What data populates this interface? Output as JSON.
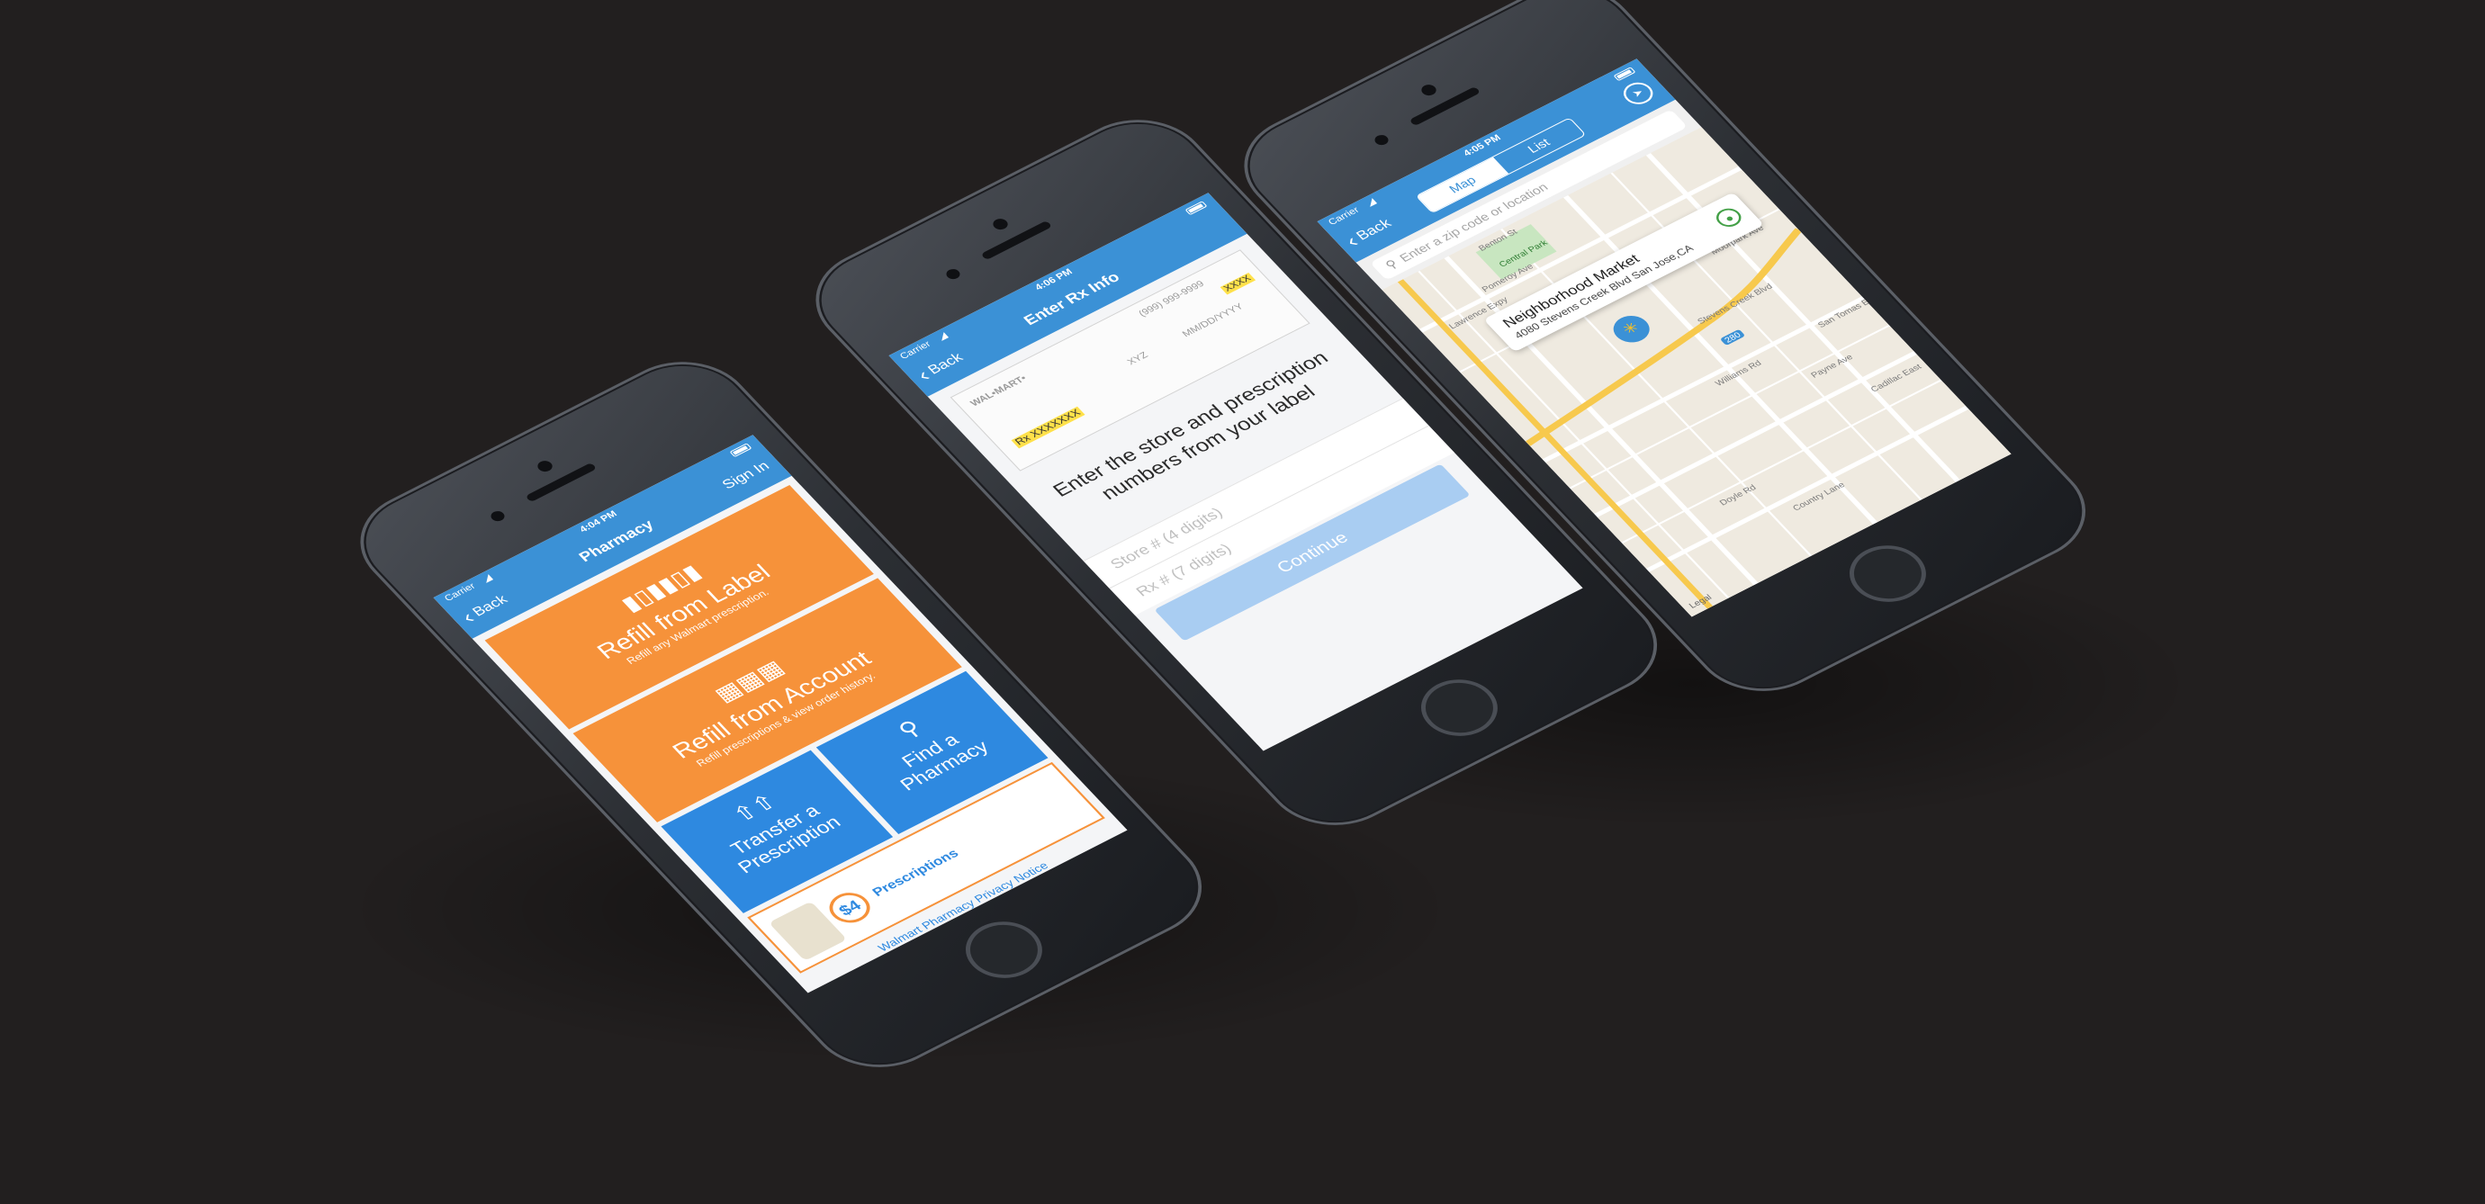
{
  "phone_pharmacy": {
    "status": {
      "carrier": "Carrier",
      "time": "4:04 PM"
    },
    "nav": {
      "back": "Back",
      "title": "Pharmacy",
      "sign_in": "Sign In"
    },
    "refill_label": {
      "title": "Refill from Label",
      "subtitle": "Refill any Walmart prescription."
    },
    "refill_account": {
      "title": "Refill from Account",
      "subtitle": "Refill prescriptions & view order history."
    },
    "transfer": {
      "title_line1": "Transfer a",
      "title_line2": "Prescription"
    },
    "find": {
      "title_line1": "Find a",
      "title_line2": "Pharmacy"
    },
    "promo": {
      "price": "$4",
      "text": "Prescriptions"
    },
    "privacy_link": "Walmart Pharmacy Privacy Notice"
  },
  "phone_rx": {
    "status": {
      "carrier": "Carrier",
      "time": "4:06 PM"
    },
    "nav": {
      "back": "Back",
      "title": "Enter Rx Info"
    },
    "label": {
      "brand": "WAL•MART•",
      "rx_number": "Rx XXXXXXX",
      "store_code": "XXXX",
      "xyz": "XYZ",
      "date": "MM/DD/YYYY",
      "phone": "(999) 999-9999"
    },
    "instructions": "Enter the store and prescription numbers from your label",
    "store_placeholder": "Store # (4 digits)",
    "rx_placeholder": "Rx # (7 digits)",
    "continue": "Continue"
  },
  "phone_map": {
    "status": {
      "carrier": "Carrier",
      "time": "4:05 PM"
    },
    "nav": {
      "back": "Back",
      "tab_map": "Map",
      "tab_list": "List"
    },
    "search_placeholder": "Enter a zip code or location",
    "map_labels": [
      "Benton St",
      "Central Park",
      "Lawrence Expy",
      "Pomeroy Ave",
      "Stevens Creek Blvd",
      "Williams Rd",
      "Payne Ave",
      "Doyle Rd",
      "Country Lane",
      "San Tomas Expy",
      "Moorpark Ave",
      "Cadillac East"
    ],
    "store": {
      "name": "Neighborhood Market",
      "address": "4080 Stevens Creek Blvd San Jose,CA"
    },
    "highway": "280",
    "legal": "Legal"
  },
  "colors": {
    "background": "#221f1f",
    "nav_blue": "#3b91d6",
    "tile_orange": "#f6923a",
    "tile_blue": "#2e89e0",
    "button_disabled": "#a9cdf2"
  }
}
